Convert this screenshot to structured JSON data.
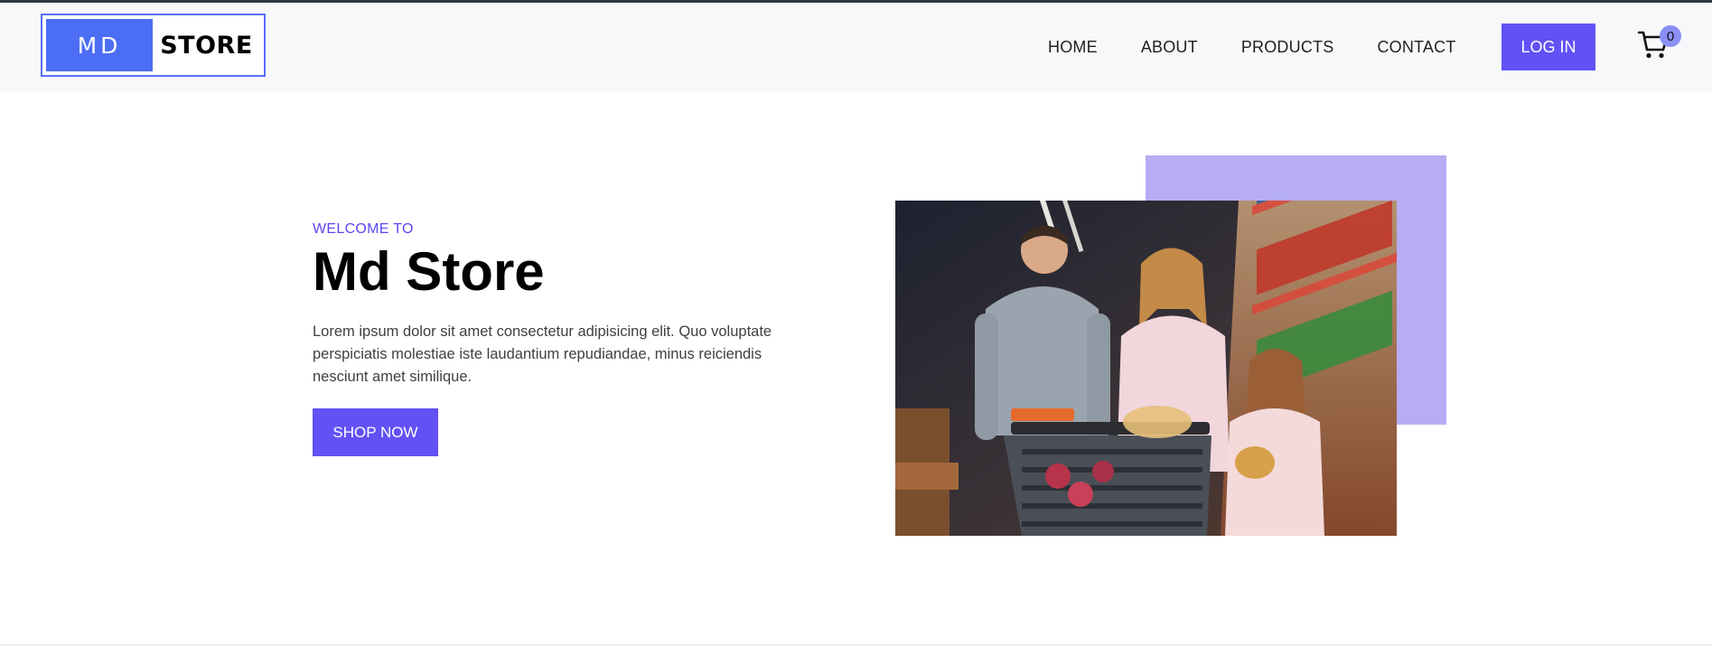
{
  "brand": {
    "logo_left": "MD",
    "logo_right": "STORE"
  },
  "nav": {
    "items": [
      {
        "label": "HOME"
      },
      {
        "label": "ABOUT"
      },
      {
        "label": "PRODUCTS"
      },
      {
        "label": "CONTACT"
      }
    ],
    "login_label": "LOG IN",
    "cart_count": "0"
  },
  "hero": {
    "kicker": "WELCOME TO",
    "title": "Md Store",
    "description": "Lorem ipsum dolor sit amet consectetur adipisicing elit. Quo voluptate perspiciatis molestiae iste laudantium repudiandae, minus reiciendis nesciunt amet similique.",
    "cta_label": "SHOP NOW"
  },
  "colors": {
    "accent": "#6251f5",
    "logo_blue": "#4c6ef5",
    "accent_box": "#b7acf6",
    "navbar_bg": "#f7f8fa"
  },
  "icons": {
    "cart": "cart-icon"
  }
}
